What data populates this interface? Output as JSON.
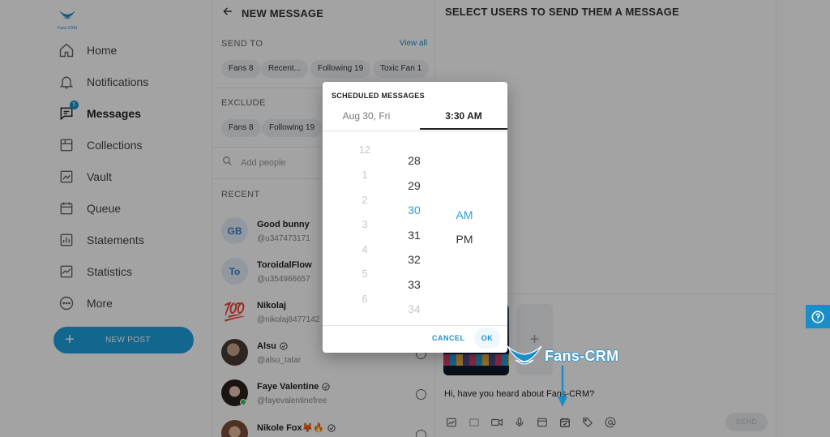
{
  "brand": {
    "logo_text": "Fans CRM",
    "accent": "#1a8ec9"
  },
  "sidebar": {
    "items": [
      {
        "label": "Home",
        "icon": "home-icon"
      },
      {
        "label": "Notifications",
        "icon": "bell-icon"
      },
      {
        "label": "Messages",
        "icon": "message-icon",
        "badge": "5"
      },
      {
        "label": "Collections",
        "icon": "collections-icon"
      },
      {
        "label": "Vault",
        "icon": "vault-icon"
      },
      {
        "label": "Queue",
        "icon": "calendar-icon"
      },
      {
        "label": "Statements",
        "icon": "statements-icon"
      },
      {
        "label": "Statistics",
        "icon": "chart-icon"
      },
      {
        "label": "More",
        "icon": "more-icon"
      }
    ],
    "new_post_label": "NEW POST"
  },
  "new_message": {
    "title": "NEW MESSAGE",
    "send_to_label": "SEND TO",
    "view_all": "View all",
    "send_to_chips": [
      "Fans 8",
      "Recent...",
      "Following 19",
      "Toxic Fan 1"
    ],
    "exclude_label": "EXCLUDE",
    "exclude_chips": [
      "Fans 8",
      "Following 19"
    ],
    "search_placeholder": "Add people",
    "recent_label": "RECENT",
    "users": [
      {
        "name": "Good bunny",
        "handle": "@u347473171",
        "initials": "GB",
        "verified": false
      },
      {
        "name": "ToroidalFlow",
        "handle": "@u354966657",
        "initials": "To",
        "verified": false
      },
      {
        "name": "Nikolaj",
        "handle": "@nikolaj8477142",
        "emoji": "💯",
        "verified": false
      },
      {
        "name": "Alsu",
        "handle": "@alsu_tatar",
        "verified": true
      },
      {
        "name": "Faye Valentine",
        "handle": "@fayevalentinefree",
        "verified": true,
        "online": true
      },
      {
        "name": "Nikole Fox🦊🔥",
        "handle": "",
        "verified": true
      }
    ]
  },
  "right_panel": {
    "title": "SELECT USERS TO SEND THEM A MESSAGE",
    "message_text": "Hi, have you heard about Fans-CRM?",
    "send_label": "SEND"
  },
  "dialog": {
    "title": "SCHEDULED MESSAGES",
    "date_tab": "Aug 30, Fri",
    "time_tab": "3:30 AM",
    "hours": [
      "12",
      "1",
      "2",
      "3",
      "4",
      "5",
      "6"
    ],
    "minutes": [
      "28",
      "29",
      "30",
      "31",
      "32",
      "33",
      "34"
    ],
    "selected_minute": "30",
    "ampm": [
      "AM",
      "PM"
    ],
    "selected_ampm": "AM",
    "cancel_label": "CANCEL",
    "ok_label": "OK"
  },
  "watermark": {
    "text": "Fans-CRM"
  }
}
